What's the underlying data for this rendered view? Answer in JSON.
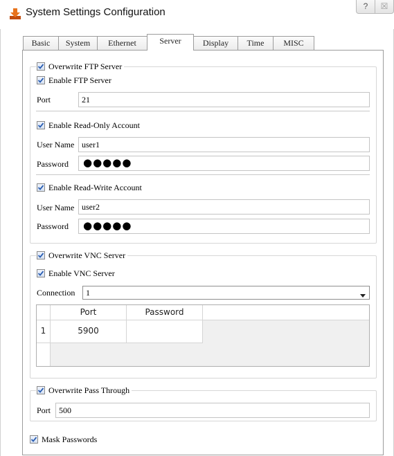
{
  "window": {
    "title": "System Settings Configuration",
    "help_label": "?",
    "close_label": "☒"
  },
  "tabs": [
    {
      "label": "Basic"
    },
    {
      "label": "System"
    },
    {
      "label": "Ethernet"
    },
    {
      "label": "Server",
      "active": true
    },
    {
      "label": "Display"
    },
    {
      "label": "Time"
    },
    {
      "label": "MISC"
    }
  ],
  "ftp": {
    "overwrite_label": "Overwrite FTP Server",
    "overwrite_checked": true,
    "enable_label": "Enable FTP Server",
    "enable_checked": true,
    "port_label": "Port",
    "port_value": "21",
    "readonly": {
      "label": "Enable Read-Only Account",
      "checked": true,
      "user_label": "User Name",
      "user_value": "user1",
      "password_label": "Password",
      "password_value": "●●●●●"
    },
    "readwrite": {
      "label": "Enable Read-Write Account",
      "checked": true,
      "user_label": "User Name",
      "user_value": "user2",
      "password_label": "Password",
      "password_value": "●●●●●"
    }
  },
  "vnc": {
    "overwrite_label": "Overwrite VNC Server",
    "overwrite_checked": true,
    "enable_label": "Enable VNC Server",
    "enable_checked": true,
    "connection_label": "Connection",
    "connection_value": "1",
    "table": {
      "columns": [
        "Port",
        "Password"
      ],
      "rows": [
        {
          "index": "1",
          "port": "5900",
          "password": ""
        }
      ]
    }
  },
  "passthrough": {
    "overwrite_label": "Overwrite Pass Through",
    "overwrite_checked": true,
    "port_label": "Port",
    "port_value": "500"
  },
  "mask_passwords": {
    "label": "Mask Passwords",
    "checked": true
  },
  "colors": {
    "icon_orange": "#e8731c",
    "check_blue": "#2b5fb3"
  }
}
